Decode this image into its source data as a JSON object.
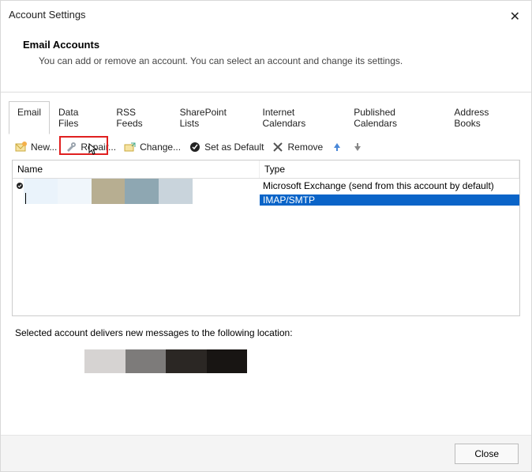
{
  "title": "Account Settings",
  "header": {
    "heading": "Email Accounts",
    "sub": "You can add or remove an account. You can select an account and change its settings."
  },
  "tabs": [
    "Email",
    "Data Files",
    "RSS Feeds",
    "SharePoint Lists",
    "Internet Calendars",
    "Published Calendars",
    "Address Books"
  ],
  "toolbar": {
    "new": "New...",
    "repair": "Repair...",
    "change": "Change...",
    "setdefault": "Set as Default",
    "remove": "Remove"
  },
  "columns": {
    "name": "Name",
    "type": "Type"
  },
  "rows": [
    {
      "name": "",
      "type": "Microsoft Exchange (send from this account by default)",
      "default": true,
      "selected": false
    },
    {
      "name": "",
      "type": "IMAP/SMTP",
      "default": false,
      "selected": true
    }
  ],
  "belowtext": "Selected account delivers new messages to the following location:",
  "footer": {
    "close": "Close"
  },
  "redaction_colors_row1": [
    "#eaf3fb",
    "#f0f6fb",
    "#b7ae91",
    "#8ea7b2",
    "#c9d4dc"
  ],
  "redaction_colors_row2": [
    "#d6d3d2",
    "#7d7b7a",
    "#2b2724",
    "#181513"
  ]
}
